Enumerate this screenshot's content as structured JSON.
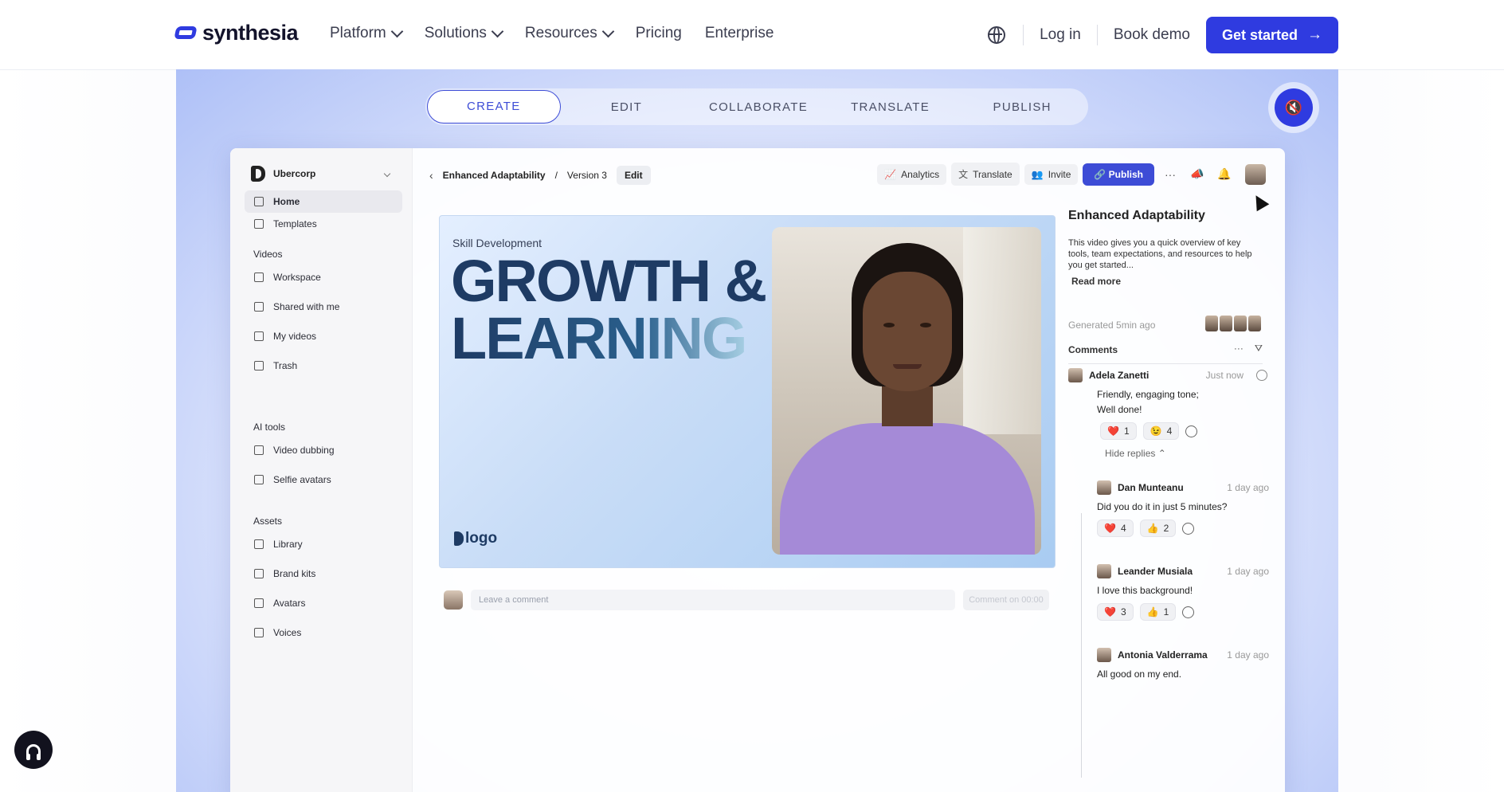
{
  "nav": {
    "brand": "synthesia",
    "links": [
      {
        "label": "Platform",
        "dropdown": true
      },
      {
        "label": "Solutions",
        "dropdown": true
      },
      {
        "label": "Resources",
        "dropdown": true
      },
      {
        "label": "Pricing",
        "dropdown": false
      },
      {
        "label": "Enterprise",
        "dropdown": false
      }
    ],
    "login": "Log in",
    "book_demo": "Book demo",
    "cta": "Get started",
    "icons": {
      "language": "globe-icon",
      "cta_arrow": "arrow-right-icon"
    }
  },
  "hero": {
    "tabs": [
      "CREATE",
      "EDIT",
      "COLLABORATE",
      "TRANSLATE",
      "PUBLISH"
    ],
    "active_tab": "CREATE",
    "mute_icon": "speaker-muted-icon"
  },
  "app": {
    "workspace": "Ubercorp",
    "sidebar": {
      "home": "Home",
      "templates": "Templates",
      "videos_heading": "Videos",
      "workspace": "Workspace",
      "shared": "Shared with me",
      "my_videos": "My videos",
      "trash": "Trash",
      "ai_heading": "AI tools",
      "dubbing": "Video dubbing",
      "selfie": "Selfie avatars",
      "assets_heading": "Assets",
      "library": "Library",
      "brand_kits": "Brand kits",
      "avatars": "Avatars",
      "voices": "Voices"
    },
    "breadcrumb": {
      "title": "Enhanced Adaptability",
      "version": "Version 3",
      "edit": "Edit"
    },
    "toolbar": {
      "analytics": "Analytics",
      "translate": "Translate",
      "invite": "Invite",
      "publish": "Publish"
    },
    "canvas": {
      "kicker": "Skill Development",
      "line1": "GROWTH &",
      "line2": "LEARNING",
      "logo": "logo"
    },
    "comment_bar": {
      "placeholder": "Leave a comment",
      "button": "Comment on 00:00"
    },
    "panel": {
      "title": "Enhanced Adaptability",
      "description": "This video gives you a quick overview of key tools, team expectations, and resources to help you get started...",
      "read_more": "Read more",
      "generated": "Generated 5min ago",
      "comments_heading": "Comments",
      "comments": [
        {
          "name": "Adela Zanetti",
          "time": "Just now",
          "text1": "Friendly, engaging tone;",
          "text2": "Well done!",
          "reacts": [
            {
              "emoji": "❤️",
              "count": "1"
            },
            {
              "emoji": "😉",
              "count": "4"
            }
          ]
        },
        {
          "name": "Dan Munteanu",
          "time": "1 day ago",
          "text": "Did you do it in just 5 minutes?",
          "reacts": [
            {
              "emoji": "❤️",
              "count": "4"
            },
            {
              "emoji": "👍",
              "count": "2"
            }
          ]
        },
        {
          "name": "Leander Musiala",
          "time": "1 day ago",
          "text": "I love this background!",
          "reacts": [
            {
              "emoji": "❤️",
              "count": "3"
            },
            {
              "emoji": "👍",
              "count": "1"
            }
          ]
        },
        {
          "name": "Antonia Valderrama",
          "time": "1 day ago",
          "text": "All good on my end."
        }
      ],
      "hide_replies": "Hide replies"
    }
  },
  "support_icon": "headset-icon",
  "colors": {
    "accent": "#2f3be0",
    "publish": "#3d4cd6"
  }
}
